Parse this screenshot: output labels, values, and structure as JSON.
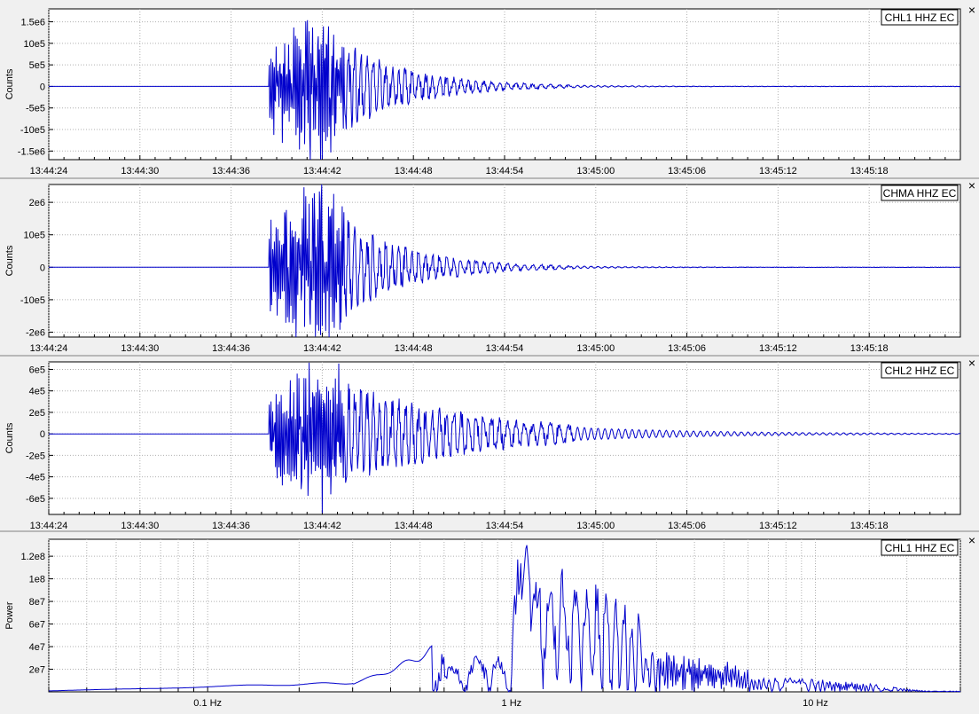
{
  "chart_data": [
    {
      "type": "line",
      "station": "CHL1 HHZ EC",
      "ylabel": "Counts",
      "x_ticks": [
        "13:44:24",
        "13:44:30",
        "13:44:36",
        "13:44:42",
        "13:44:48",
        "13:44:54",
        "13:45:00",
        "13:45:06",
        "13:45:12",
        "13:45:18"
      ],
      "y_ticks": [
        {
          "v": 1500000,
          "l": "1.5e6"
        },
        {
          "v": 1000000,
          "l": "10e5"
        },
        {
          "v": 500000,
          "l": "5e5"
        },
        {
          "v": 0,
          "l": "0"
        },
        {
          "v": -500000,
          "l": "-5e5"
        },
        {
          "v": -1000000,
          "l": "-10e5"
        },
        {
          "v": -1500000,
          "l": "-1.5e6"
        }
      ],
      "ylim": [
        -1700000,
        1800000
      ],
      "xlim_seconds_from_13_44_24": [
        0,
        60
      ],
      "grid": true,
      "series": [
        {
          "name": "CHL1 HHZ EC",
          "color": "#0000cc",
          "onset_s": 14.5,
          "peak_counts": 1700000
        }
      ]
    },
    {
      "type": "line",
      "station": "CHMA HHZ EC",
      "ylabel": "Counts",
      "x_ticks": [
        "13:44:24",
        "13:44:30",
        "13:44:36",
        "13:44:42",
        "13:44:48",
        "13:44:54",
        "13:45:00",
        "13:45:06",
        "13:45:12",
        "13:45:18"
      ],
      "y_ticks": [
        {
          "v": 2000000,
          "l": "2e6"
        },
        {
          "v": 1000000,
          "l": "10e5"
        },
        {
          "v": 0,
          "l": "0"
        },
        {
          "v": -1000000,
          "l": "-10e5"
        },
        {
          "v": -2000000,
          "l": "-2e6"
        }
      ],
      "ylim": [
        -2150000,
        2550000
      ],
      "xlim_seconds_from_13_44_24": [
        0,
        60
      ],
      "grid": true,
      "series": [
        {
          "name": "CHMA HHZ EC",
          "color": "#0000cc",
          "onset_s": 14.5,
          "peak_counts": 2450000
        }
      ]
    },
    {
      "type": "line",
      "station": "CHL2 HHZ EC",
      "ylabel": "Counts",
      "x_ticks": [
        "13:44:24",
        "13:44:30",
        "13:44:36",
        "13:44:42",
        "13:44:48",
        "13:44:54",
        "13:45:00",
        "13:45:06",
        "13:45:12",
        "13:45:18"
      ],
      "y_ticks": [
        {
          "v": 600000,
          "l": "6e5"
        },
        {
          "v": 400000,
          "l": "4e5"
        },
        {
          "v": 200000,
          "l": "2e5"
        },
        {
          "v": 0,
          "l": "0"
        },
        {
          "v": -200000,
          "l": "-2e5"
        },
        {
          "v": -400000,
          "l": "-4e5"
        },
        {
          "v": -600000,
          "l": "-6e5"
        }
      ],
      "ylim": [
        -750000,
        670000
      ],
      "xlim_seconds_from_13_44_24": [
        0,
        60
      ],
      "grid": true,
      "series": [
        {
          "name": "CHL2 HHZ EC",
          "color": "#0000cc",
          "onset_s": 14.5,
          "peak_counts": 650000
        }
      ]
    },
    {
      "type": "line",
      "station": "CHL1 HHZ EC",
      "ylabel": "Power",
      "x_scale": "log",
      "xlim_hz": [
        0.03,
        30
      ],
      "x_ticks": [
        {
          "v": 0.1,
          "l": "0.1 Hz"
        },
        {
          "v": 1,
          "l": "1 Hz"
        },
        {
          "v": 10,
          "l": "10 Hz"
        }
      ],
      "y_ticks": [
        {
          "v": 20000000,
          "l": "2e7"
        },
        {
          "v": 40000000,
          "l": "4e7"
        },
        {
          "v": 60000000,
          "l": "6e7"
        },
        {
          "v": 80000000,
          "l": "8e7"
        },
        {
          "v": 100000000,
          "l": "1e8"
        },
        {
          "v": 120000000,
          "l": "1.2e8"
        }
      ],
      "ylim": [
        0,
        135000000
      ],
      "grid": true,
      "series": [
        {
          "name": "CHL1 HHZ EC",
          "color": "#0000cc",
          "peak_hz": 1.12,
          "peak_power": 134000000
        }
      ]
    }
  ],
  "close_symbol": "×"
}
